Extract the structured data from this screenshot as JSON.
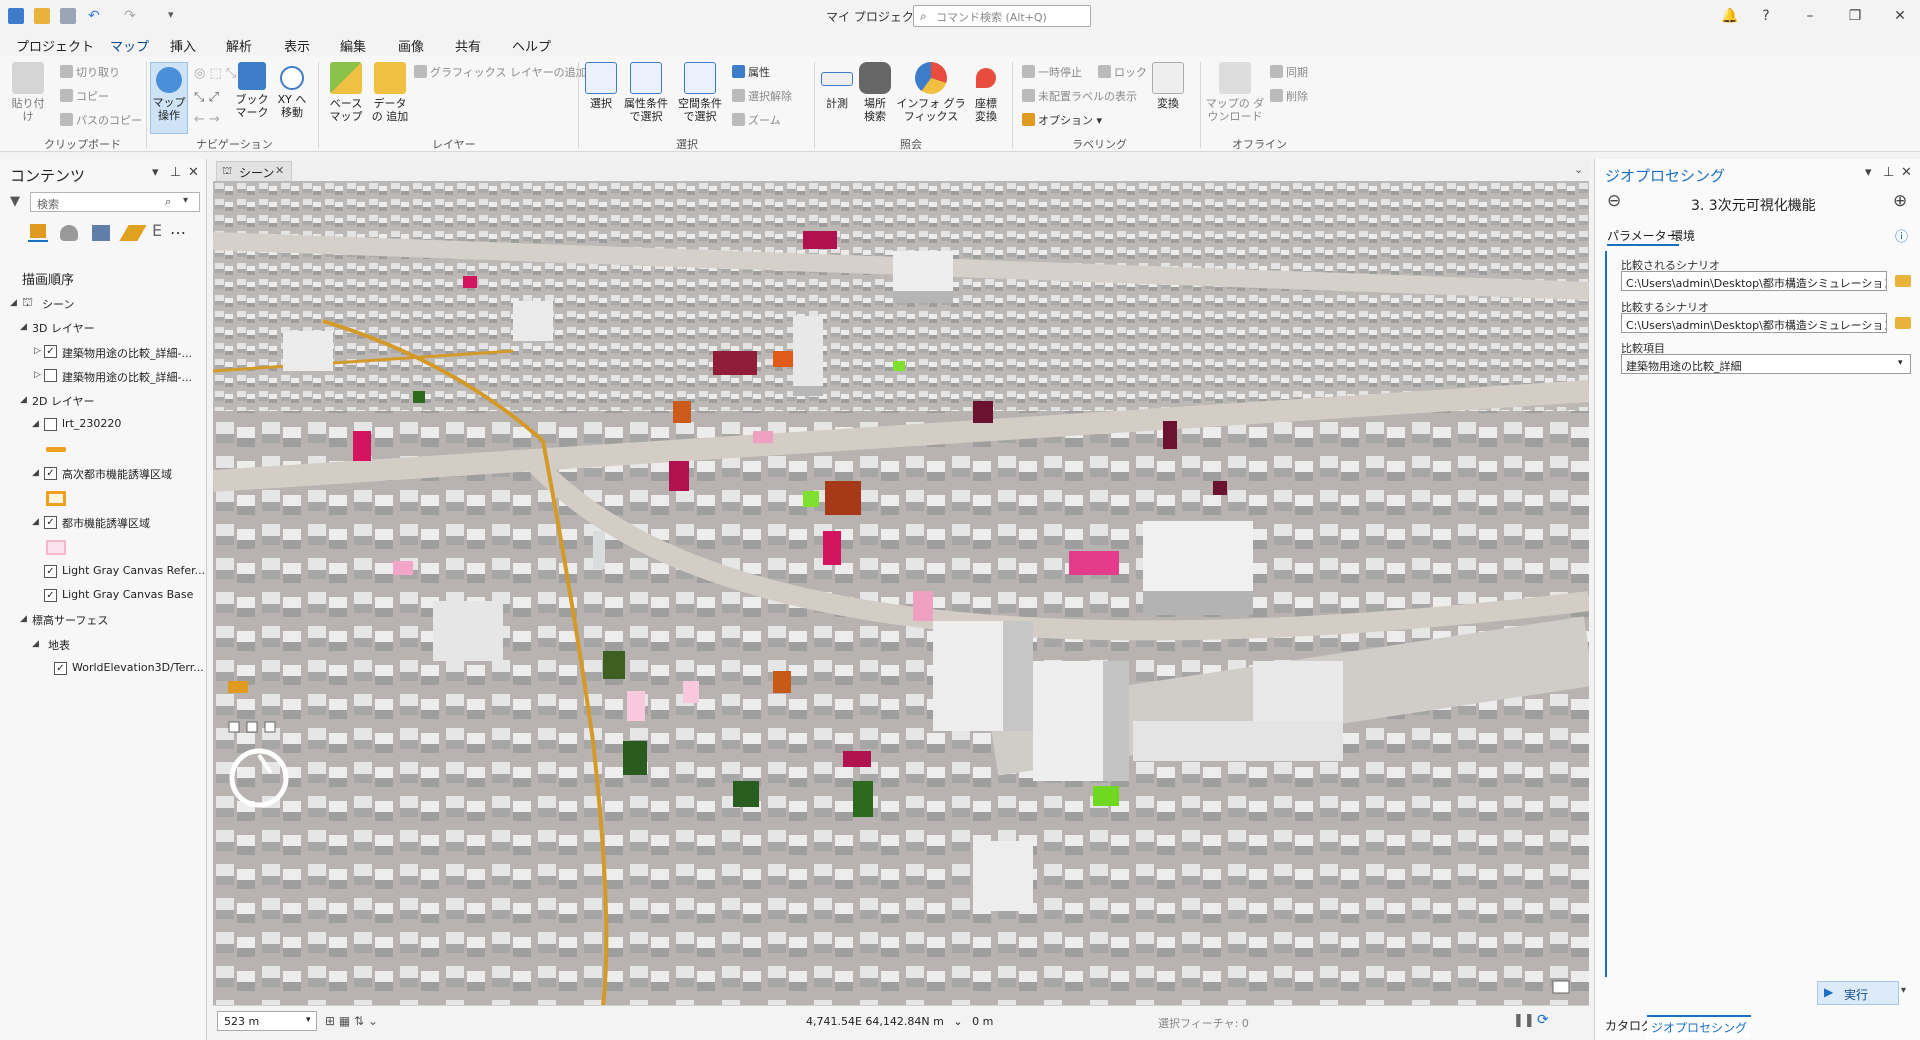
{
  "titlebar": {
    "project_name": "マイ プロジェクト",
    "command_search_placeholder": "コマンド検索 (Alt+Q)"
  },
  "ribbon": {
    "tabs": [
      "プロジェクト",
      "マップ",
      "挿入",
      "解析",
      "表示",
      "編集",
      "画像",
      "共有",
      "ヘルプ"
    ],
    "active_tab": "マップ",
    "clipboard": {
      "label": "クリップボード",
      "paste": "貼り付け",
      "cut": "切り取り",
      "copy": "コピー",
      "copy_path": "パスのコピー"
    },
    "navigation": {
      "label": "ナビゲーション",
      "explore": "マップ 操作",
      "bookmarks": "ブック マーク",
      "goto_xy": "XY へ移動"
    },
    "layer": {
      "label": "レイヤー",
      "basemap": "ベース マップ",
      "add_data": "データの 追加",
      "add_graphics": "グラフィックス レイヤーの追加"
    },
    "selection": {
      "label": "選択",
      "select": "選択",
      "by_attributes": "属性条件 で選択",
      "by_location": "空間条件 で選択",
      "attributes": "属性",
      "clear": "選択解除",
      "zoom": "ズーム"
    },
    "inquiry": {
      "label": "照会",
      "measure": "計測",
      "locate": "場所 検索",
      "infographics": "インフォ グラフィックス",
      "convert_coords": "座標 変換"
    },
    "labeling": {
      "label": "ラベリング",
      "pause": "一時停止",
      "lock": "ロック",
      "unplaced": "未配置ラベルの表示",
      "options": "オプション",
      "convert": "変換"
    },
    "offline": {
      "label": "オフライン",
      "download_map": "マップの ダウンロード",
      "sync": "同期",
      "remove": "削除"
    }
  },
  "contents": {
    "title": "コンテンツ",
    "search_placeholder": "検索",
    "drawing_order": "描画順序",
    "items": {
      "scene": "シーン",
      "layers3d": "3D レイヤー",
      "building_detail_1": "建築物用途の比較_詳細-...",
      "building_detail_2": "建築物用途の比較_詳細-...",
      "layers2d": "2D レイヤー",
      "lrt": "lrt_230220",
      "advanced_area": "高次都市機能誘導区域",
      "urban_area": "都市機能誘導区域",
      "lgc_reference": "Light Gray Canvas Refer...",
      "lgc_base": "Light Gray Canvas Base",
      "elevation_surfaces": "標高サーフェス",
      "ground": "地表",
      "world_elevation": "WorldElevation3D/Terr..."
    }
  },
  "scene_view": {
    "tab_label": "シーン",
    "scale": "523 m",
    "coordinates": "4,741.54E 64,142.84N m",
    "elevation": "0 m",
    "selected_features": "選択フィーチャ: 0"
  },
  "geoprocessing": {
    "title": "ジオプロセシング",
    "tool_name": "3. 3次元可視化機能",
    "tabs": [
      "パラメーター",
      "環境"
    ],
    "params": [
      {
        "label": "比較されるシナリオ",
        "value": "C:\\Users\\admin\\Desktop\\都市構造シミュレーション\\"
      },
      {
        "label": "比較するシナリオ",
        "value": "C:\\Users\\admin\\Desktop\\都市構造シミュレーション\\"
      },
      {
        "label": "比較項目",
        "value": "建築物用途の比較_詳細"
      }
    ],
    "run_label": "実行",
    "bottom_tabs": [
      "カタログ",
      "ジオプロセシング"
    ]
  },
  "colors": {
    "accent": "#1b6fc2",
    "lrt_symbol": "#f0a020",
    "advanced_area_symbol": "#f0a020",
    "urban_area_symbol": "#f6c8dc"
  }
}
